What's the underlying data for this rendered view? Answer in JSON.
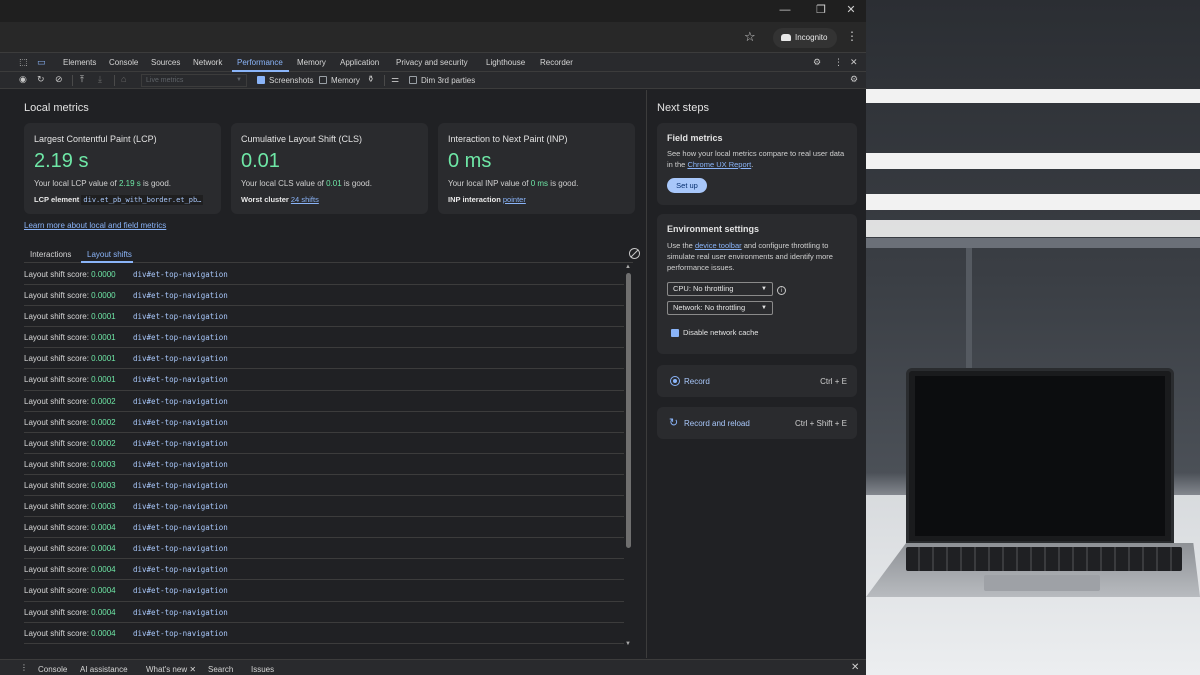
{
  "window": {
    "controls": [
      "—",
      "❐",
      "✕"
    ]
  },
  "browser": {
    "incognito_label": "Incognito"
  },
  "devtools_tabs": [
    "Elements",
    "Console",
    "Sources",
    "Network",
    "Performance",
    "Memory",
    "Application",
    "Privacy and security",
    "Lighthouse",
    "Recorder"
  ],
  "active_tab": "Performance",
  "toolbar": {
    "live_metrics_placeholder": "Live metrics",
    "screenshots_label": "Screenshots",
    "memory_label": "Memory",
    "dim_label": "Dim 3rd parties",
    "screenshots_checked": true,
    "memory_checked": false,
    "dim_checked": false
  },
  "local_metrics": {
    "title": "Local metrics",
    "cards": [
      {
        "title": "Largest Contentful Paint (LCP)",
        "value": "2.19 s",
        "desc_pre": "Your local LCP value of ",
        "desc_val": "2.19 s",
        "desc_post": " is good.",
        "foot_label": "LCP element",
        "foot_value": "div.et_pb_with_border.et_pb…"
      },
      {
        "title": "Cumulative Layout Shift (CLS)",
        "value": "0.01",
        "desc_pre": "Your local CLS value of ",
        "desc_val": "0.01",
        "desc_post": " is good.",
        "foot_label": "Worst cluster",
        "foot_value": "24 shifts"
      },
      {
        "title": "Interaction to Next Paint (INP)",
        "value": "0 ms",
        "desc_pre": "Your local INP value of ",
        "desc_val": "0 ms",
        "desc_post": " is good.",
        "foot_label": "INP interaction",
        "foot_value": "pointer"
      }
    ],
    "learn_link": "Learn more about local and field metrics"
  },
  "subtabs": {
    "interactions": "Interactions",
    "layout_shifts": "Layout shifts"
  },
  "shifts": {
    "label": "Layout shift score: ",
    "node": "div#et-top-navigation",
    "scores": [
      "0.0000",
      "0.0000",
      "0.0001",
      "0.0001",
      "0.0001",
      "0.0001",
      "0.0002",
      "0.0002",
      "0.0002",
      "0.0003",
      "0.0003",
      "0.0003",
      "0.0004",
      "0.0004",
      "0.0004",
      "0.0004",
      "0.0004",
      "0.0004"
    ]
  },
  "next_steps": {
    "title": "Next steps",
    "field": {
      "title": "Field metrics",
      "text_pre": "See how your local metrics compare to real user data in the ",
      "text_link": "Chrome UX Report",
      "text_post": ".",
      "button": "Set up"
    },
    "env": {
      "title": "Environment settings",
      "text_pre": "Use the ",
      "text_link": "device toolbar",
      "text_post": " and configure throttling to simulate real user environments and identify more performance issues.",
      "cpu": "CPU: No throttling",
      "network": "Network: No throttling",
      "cache": "Disable network cache"
    },
    "record": {
      "label": "Record",
      "key": "Ctrl + E"
    },
    "record_reload": {
      "label": "Record and reload",
      "key": "Ctrl + Shift + E"
    }
  },
  "drawer_tabs": [
    "Console",
    "AI assistance",
    "What's new",
    "Search",
    "Issues"
  ],
  "colors": {
    "good": "#6ee7a6",
    "accent": "#8ab4f8"
  }
}
